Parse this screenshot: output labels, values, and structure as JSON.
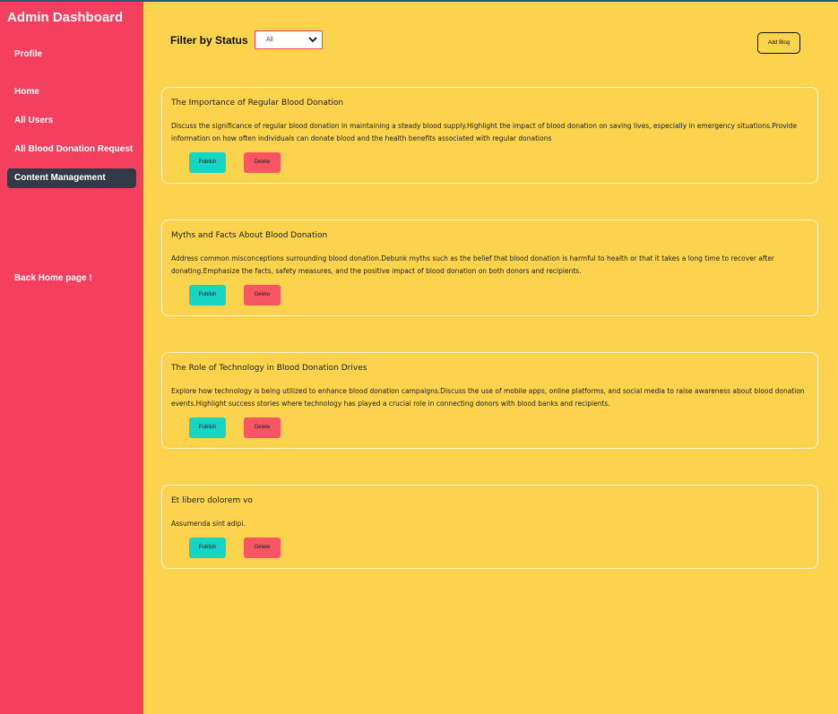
{
  "sidebar": {
    "title": "Admin Dashboard",
    "items": [
      {
        "label": "Profile"
      },
      {
        "label": "Home"
      },
      {
        "label": "All Users"
      },
      {
        "label": "All Blood Donation Request"
      },
      {
        "label": "Content Management",
        "active": true
      },
      {
        "label": "Back Home page !"
      }
    ]
  },
  "filter": {
    "label": "Filter by Status",
    "selected": "All"
  },
  "add_blog_label": "Add Blog",
  "blogs": [
    {
      "title": "The Importance of Regular Blood Donation",
      "body": "Discuss the significance of regular blood donation in maintaining a steady blood supply.Highlight the impact of blood donation on saving lives, especially in emergency situations.Provide information on how often individuals can donate blood and the health benefits associated with regular donations",
      "publish_label": "Publish",
      "delete_label": "Delete"
    },
    {
      "title": "Myths and Facts About Blood Donation",
      "body": "Address common misconceptions surrounding blood donation.Debunk myths such as the belief that blood donation is harmful to health or that it takes a long time to recover after donating.Emphasize the facts, safety measures, and the positive impact of blood donation on both donors and recipients.",
      "publish_label": "Publish",
      "delete_label": "Delete"
    },
    {
      "title": "The Role of Technology in Blood Donation Drives",
      "body": "Explore how technology is being utilized to enhance blood donation campaigns.Discuss the use of mobile apps, online platforms, and social media to raise awareness about blood donation events.Highlight success stories where technology has played a crucial role in connecting donors with blood banks and recipients.",
      "publish_label": "Publish",
      "delete_label": "Delete"
    },
    {
      "title": "Et libero dolorem vo",
      "body": "Assumenda sint adipi.",
      "publish_label": "Publish",
      "delete_label": "Delete"
    }
  ],
  "colors": {
    "sidebar_bg": "#f43f5e",
    "main_bg": "#fcd34d",
    "active_item_bg": "#333a47",
    "publish_button": "#14d6c4",
    "delete_button": "#f75562"
  }
}
